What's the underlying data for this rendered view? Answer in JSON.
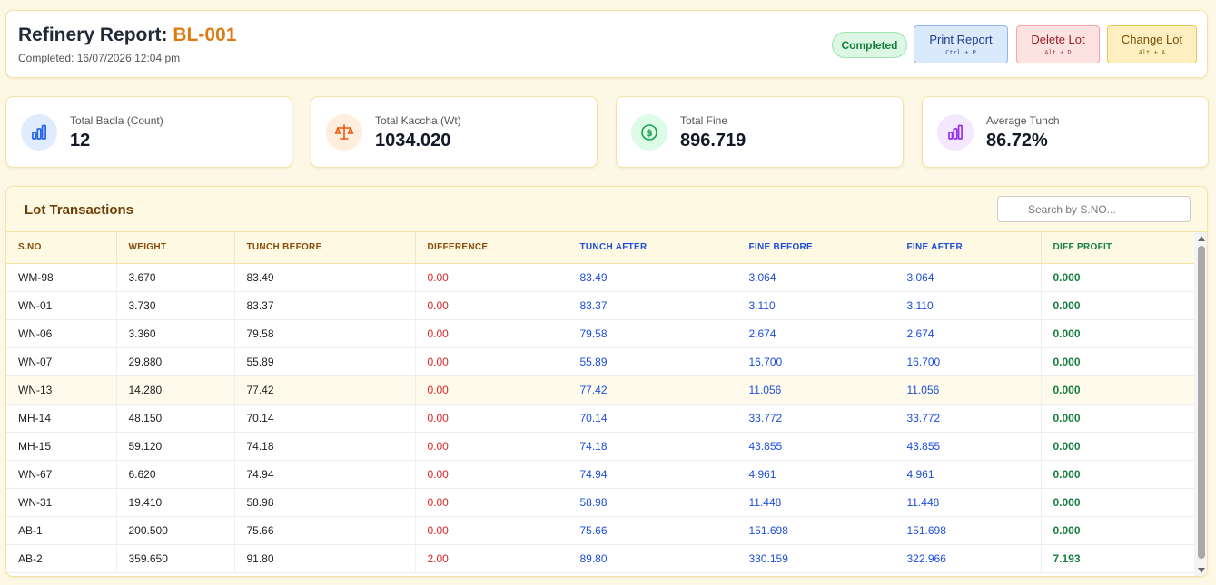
{
  "header": {
    "title_prefix": "Refinery Report:",
    "lot_id": "BL-001",
    "completed_text": "Completed: 16/07/2026 12:04 pm",
    "status_badge": "Completed",
    "buttons": {
      "print": {
        "label": "Print Report",
        "shortcut": "Ctrl + P"
      },
      "delete": {
        "label": "Delete Lot",
        "shortcut": "Alt + D"
      },
      "change": {
        "label": "Change Lot",
        "shortcut": "Alt + A"
      }
    }
  },
  "stats": [
    {
      "label": "Total Badla (Count)",
      "value": "12",
      "icon": "bar-chart-icon",
      "color": "#2563eb",
      "bg": "#e0ecfd"
    },
    {
      "label": "Total Kaccha (Wt)",
      "value": "1034.020",
      "icon": "scale-icon",
      "color": "#ea580c",
      "bg": "#ffeedd"
    },
    {
      "label": "Total Fine",
      "value": "896.719",
      "icon": "dollar-icon",
      "color": "#16a34a",
      "bg": "#dcfce7"
    },
    {
      "label": "Average Tunch",
      "value": "86.72%",
      "icon": "bar-chart-icon",
      "color": "#9333ea",
      "bg": "#f3e8ff"
    }
  ],
  "transactions": {
    "title": "Lot Transactions",
    "search_placeholder": "Search by S.NO...",
    "columns": [
      "S.NO",
      "WEIGHT",
      "TUNCH BEFORE",
      "DIFFERENCE",
      "TUNCH AFTER",
      "FINE BEFORE",
      "FINE AFTER",
      "DIFF PROFIT"
    ],
    "rows": [
      [
        "WM-98",
        "3.670",
        "83.49",
        "0.00",
        "83.49",
        "3.064",
        "3.064",
        "0.000"
      ],
      [
        "WN-01",
        "3.730",
        "83.37",
        "0.00",
        "83.37",
        "3.110",
        "3.110",
        "0.000"
      ],
      [
        "WN-06",
        "3.360",
        "79.58",
        "0.00",
        "79.58",
        "2.674",
        "2.674",
        "0.000"
      ],
      [
        "WN-07",
        "29.880",
        "55.89",
        "0.00",
        "55.89",
        "16.700",
        "16.700",
        "0.000"
      ],
      [
        "WN-13",
        "14.280",
        "77.42",
        "0.00",
        "77.42",
        "11.056",
        "11.056",
        "0.000"
      ],
      [
        "MH-14",
        "48.150",
        "70.14",
        "0.00",
        "70.14",
        "33.772",
        "33.772",
        "0.000"
      ],
      [
        "MH-15",
        "59.120",
        "74.18",
        "0.00",
        "74.18",
        "43.855",
        "43.855",
        "0.000"
      ],
      [
        "WN-67",
        "6.620",
        "74.94",
        "0.00",
        "74.94",
        "4.961",
        "4.961",
        "0.000"
      ],
      [
        "WN-31",
        "19.410",
        "58.98",
        "0.00",
        "58.98",
        "11.448",
        "11.448",
        "0.000"
      ],
      [
        "AB-1",
        "200.500",
        "75.66",
        "0.00",
        "75.66",
        "151.698",
        "151.698",
        "0.000"
      ],
      [
        "AB-2",
        "359.650",
        "91.80",
        "2.00",
        "89.80",
        "330.159",
        "322.966",
        "7.193"
      ]
    ],
    "highlighted_row": 4
  }
}
